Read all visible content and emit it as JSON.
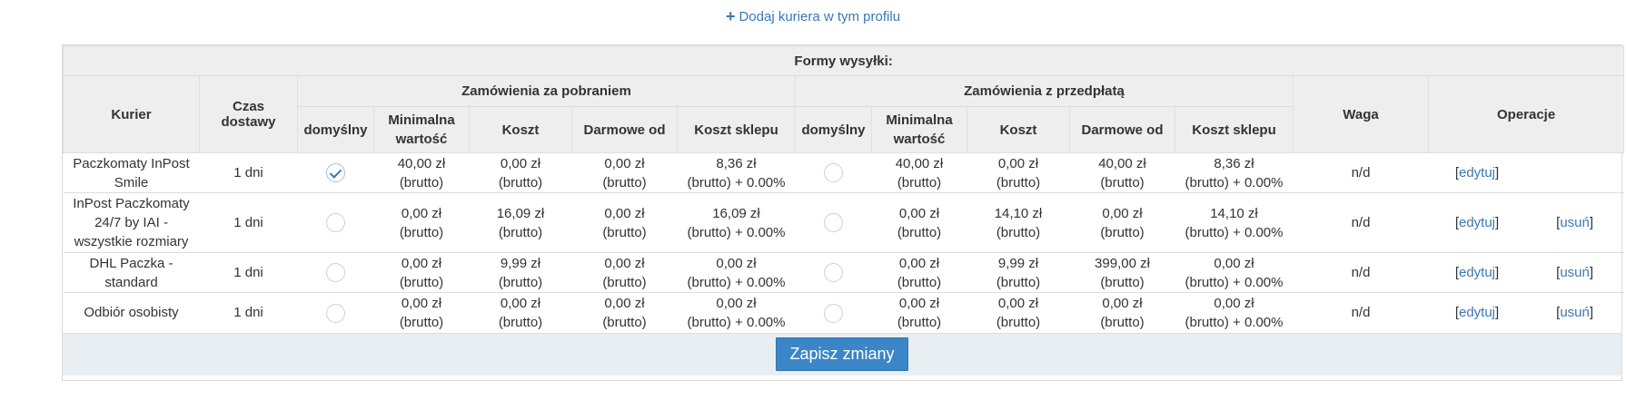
{
  "add_courier_link": "Dodaj kuriera w tym profilu",
  "table": {
    "title": "Formy wysyłki:",
    "groups": {
      "cod": "Zamówienia za pobraniem",
      "prepaid": "Zamówienia z przedpłatą"
    },
    "headers": {
      "courier": "Kurier",
      "delivery_time": "Czas dostawy",
      "default": "domyślny",
      "min_value": "Minimalna wartość",
      "cost": "Koszt",
      "free_from": "Darmowe od",
      "shop_cost": "Koszt sklepu",
      "weight": "Waga",
      "operations": "Operacje"
    },
    "rows": [
      {
        "courier": "Paczkomaty InPost Smile",
        "time": "1 dni",
        "cod": {
          "default": true,
          "min": [
            "40,00 zł",
            "(brutto)"
          ],
          "cost": [
            "0,00 zł",
            "(brutto)"
          ],
          "free": [
            "0,00 zł",
            "(brutto)"
          ],
          "shop": [
            "8,36 zł",
            "(brutto) + 0.00%"
          ]
        },
        "pre": {
          "default": false,
          "min": [
            "40,00 zł",
            "(brutto)"
          ],
          "cost": [
            "0,00 zł",
            "(brutto)"
          ],
          "free": [
            "40,00 zł",
            "(brutto)"
          ],
          "shop": [
            "8,36 zł",
            "(brutto) + 0.00%"
          ]
        },
        "weight": "n/d",
        "edit": "edytuj",
        "remove": ""
      },
      {
        "courier": "InPost Paczkomaty 24/7 by IAI - wszystkie rozmiary",
        "time": "1 dni",
        "cod": {
          "default": false,
          "min": [
            "0,00 zł",
            "(brutto)"
          ],
          "cost": [
            "16,09 zł",
            "(brutto)"
          ],
          "free": [
            "0,00 zł",
            "(brutto)"
          ],
          "shop": [
            "16,09 zł",
            "(brutto) + 0.00%"
          ]
        },
        "pre": {
          "default": false,
          "min": [
            "0,00 zł",
            "(brutto)"
          ],
          "cost": [
            "14,10 zł",
            "(brutto)"
          ],
          "free": [
            "0,00 zł",
            "(brutto)"
          ],
          "shop": [
            "14,10 zł",
            "(brutto) + 0.00%"
          ]
        },
        "weight": "n/d",
        "edit": "edytuj",
        "remove": "usuń"
      },
      {
        "courier": "DHL Paczka - standard",
        "time": "1 dni",
        "cod": {
          "default": false,
          "min": [
            "0,00 zł",
            "(brutto)"
          ],
          "cost": [
            "9,99 zł",
            "(brutto)"
          ],
          "free": [
            "0,00 zł",
            "(brutto)"
          ],
          "shop": [
            "0,00 zł",
            "(brutto) + 0.00%"
          ]
        },
        "pre": {
          "default": false,
          "min": [
            "0,00 zł",
            "(brutto)"
          ],
          "cost": [
            "9,99 zł",
            "(brutto)"
          ],
          "free": [
            "399,00 zł",
            "(brutto)"
          ],
          "shop": [
            "0,00 zł",
            "(brutto) + 0.00%"
          ]
        },
        "weight": "n/d",
        "edit": "edytuj",
        "remove": "usuń"
      },
      {
        "courier": "Odbiór osobisty",
        "time": "1 dni",
        "cod": {
          "default": false,
          "min": [
            "0,00 zł",
            "(brutto)"
          ],
          "cost": [
            "0,00 zł",
            "(brutto)"
          ],
          "free": [
            "0,00 zł",
            "(brutto)"
          ],
          "shop": [
            "0,00 zł",
            "(brutto) + 0.00%"
          ]
        },
        "pre": {
          "default": false,
          "min": [
            "0,00 zł",
            "(brutto)"
          ],
          "cost": [
            "0,00 zł",
            "(brutto)"
          ],
          "free": [
            "0,00 zł",
            "(brutto)"
          ],
          "shop": [
            "0,00 zł",
            "(brutto) + 0.00%"
          ]
        },
        "weight": "n/d",
        "edit": "edytuj",
        "remove": "usuń"
      }
    ]
  },
  "save_button": "Zapisz zmiany",
  "colors": {
    "accent": "#3a78b5",
    "button": "#3a86c6",
    "header_bg": "#eeeeee",
    "footer_bg": "#e9eef3"
  }
}
